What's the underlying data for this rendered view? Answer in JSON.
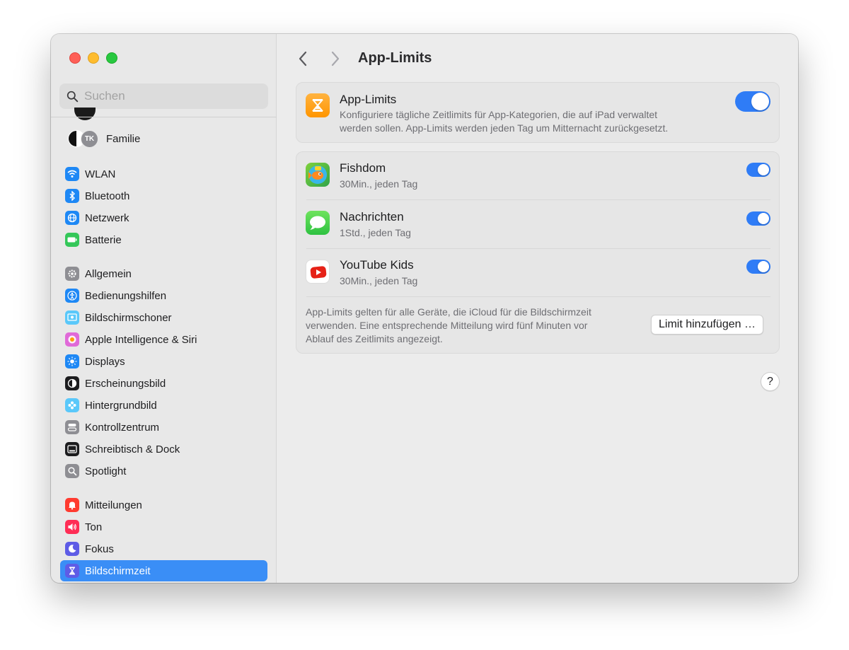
{
  "sidebar": {
    "search_placeholder": "Suchen",
    "family_label": "Familie",
    "family_avatar_initials": "TK",
    "groups": [
      [
        {
          "label": "WLAN",
          "icon": "wifi-icon",
          "color": "#1e88f5"
        },
        {
          "label": "Bluetooth",
          "icon": "bluetooth-icon",
          "color": "#1e88f5"
        },
        {
          "label": "Netzwerk",
          "icon": "globe-icon",
          "color": "#1e88f5"
        },
        {
          "label": "Batterie",
          "icon": "battery-icon",
          "color": "#34c759"
        }
      ],
      [
        {
          "label": "Allgemein",
          "icon": "gear-icon",
          "color": "#8e8e93"
        },
        {
          "label": "Bedienungshilfen",
          "icon": "accessibility-icon",
          "color": "#1e88f5"
        },
        {
          "label": "Bildschirmschoner",
          "icon": "screensaver-icon",
          "color": "#5ac8fa"
        },
        {
          "label": "Apple Intelligence & Siri",
          "icon": "siri-icon",
          "color": "#e06ad8"
        },
        {
          "label": "Displays",
          "icon": "sun-icon",
          "color": "#1e88f5"
        },
        {
          "label": "Erscheinungsbild",
          "icon": "appearance-icon",
          "color": "#1c1c1e"
        },
        {
          "label": "Hintergrundbild",
          "icon": "wallpaper-icon",
          "color": "#5ac8fa"
        },
        {
          "label": "Kontrollzentrum",
          "icon": "control-center-icon",
          "color": "#8e8e93"
        },
        {
          "label": "Schreibtisch & Dock",
          "icon": "dock-icon",
          "color": "#1c1c1e"
        },
        {
          "label": "Spotlight",
          "icon": "magnifier-icon",
          "color": "#8e8e93"
        }
      ],
      [
        {
          "label": "Mitteilungen",
          "icon": "bell-icon",
          "color": "#ff3b30"
        },
        {
          "label": "Ton",
          "icon": "speaker-icon",
          "color": "#ff2d55"
        },
        {
          "label": "Fokus",
          "icon": "moon-icon",
          "color": "#5e5ce6"
        },
        {
          "label": "Bildschirmzeit",
          "icon": "hourglass-icon",
          "color": "#5e5ce6",
          "active": true
        }
      ]
    ]
  },
  "main": {
    "title": "App-Limits",
    "top": {
      "title": "App-Limits",
      "description_line1": "Konfiguriere tägliche Zeitlimits für App-Kategorien, die auf iPad verwaltet",
      "description_line2": "werden sollen. App-Limits werden jeden Tag um Mitternacht zurückgesetzt.",
      "enabled": true
    },
    "apps": [
      {
        "name": "Fishdom",
        "limit": "30Min., jeden Tag",
        "icon": "fishdom-icon",
        "enabled": true
      },
      {
        "name": "Nachrichten",
        "limit": "1Std., jeden Tag",
        "icon": "messages-icon",
        "enabled": true
      },
      {
        "name": "YouTube Kids",
        "limit": "30Min., jeden Tag",
        "icon": "youtube-kids-icon",
        "enabled": true
      }
    ],
    "footer_line1": "App-Limits gelten für alle Geräte, die iCloud für die Bildschirmzeit",
    "footer_line2": "verwenden. Eine entsprechende Mitteilung wird fünf Minuten vor",
    "footer_line3": "Ablauf des Zeitlimits angezeigt.",
    "add_button": "Limit hinzufügen …",
    "help_button": "?"
  }
}
